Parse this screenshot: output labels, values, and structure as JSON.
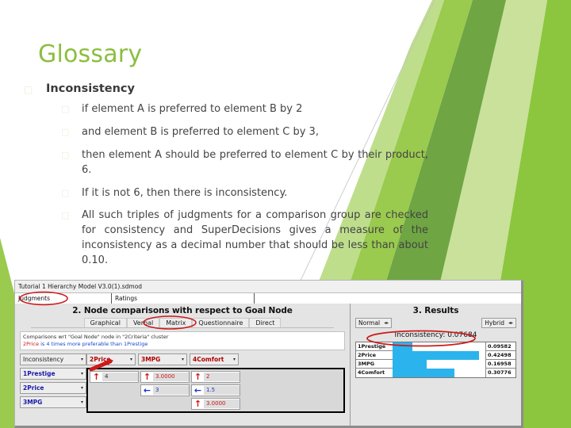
{
  "slide": {
    "title": "Glossary",
    "title_color": "#8CBE3F",
    "bullets": [
      {
        "level": 1,
        "marker": "□",
        "text": "Inconsistency"
      },
      {
        "level": 2,
        "marker": "□",
        "text": "if element A is preferred to element B by 2"
      },
      {
        "level": 2,
        "marker": "□",
        "text": "and element B is preferred to element C by 3,"
      },
      {
        "level": 2,
        "marker": "□",
        "text": "then element A should be preferred to element C by their product, 6."
      },
      {
        "level": 2,
        "marker": "□",
        "text": "If it is not 6, then there is inconsistency."
      },
      {
        "level": 2,
        "marker": "□",
        "text": "All such triples of judgments for a comparison group are checked for consistency and SuperDecisions gives a measure of the inconsistency as a decimal number that should be less than about 0.10."
      }
    ]
  },
  "app": {
    "window_title": "Tutorial 1 Hierarchy Model V3.0(1).sdmod",
    "tabs": [
      {
        "label": "Judgments",
        "circled": true
      },
      {
        "label": "Ratings",
        "circled": false
      }
    ],
    "left_pane": {
      "heading": "2. Node comparisons with respect to Goal Node",
      "method_tabs": [
        {
          "label": "Graphical",
          "selected": false
        },
        {
          "label": "Verbal",
          "selected": false
        },
        {
          "label": "Matrix",
          "selected": true
        },
        {
          "label": "Questionnaire",
          "selected": false
        },
        {
          "label": "Direct",
          "selected": false
        }
      ],
      "note_line1": "Comparisons wrt \"Goal Node\" node in \"2Criteria\" cluster",
      "note_line2_a": "2Price",
      "note_line2_b": "is 4 times more preferable than",
      "note_line2_c": "1Prestige",
      "inconsistency_button": "Inconsistency",
      "column_headers": [
        "2Price",
        "3MPG",
        "4Comfort"
      ],
      "row_headers": [
        "1Prestige",
        "2Price",
        "3MPG"
      ],
      "matrix": [
        [
          {
            "arrow": "up",
            "value": "4"
          },
          {
            "arrow": "up",
            "value": "3.0000"
          },
          {
            "arrow": "up",
            "value": "2"
          }
        ],
        [
          {
            "arrow": "none",
            "value": ""
          },
          {
            "arrow": "left",
            "value": "3"
          },
          {
            "arrow": "left",
            "value": "1.5"
          }
        ],
        [
          {
            "arrow": "none",
            "value": ""
          },
          {
            "arrow": "none",
            "value": ""
          },
          {
            "arrow": "up",
            "value": "3.0000"
          }
        ]
      ]
    },
    "right_pane": {
      "heading": "3. Results",
      "normalize_select": "Normal",
      "mode_select": "Hybrid",
      "inconsistency_label": "Inconsistency: 0.07684",
      "results": [
        {
          "name": "1Prestige",
          "value": "0.09582",
          "bar_pct": 21
        },
        {
          "name": "2Price",
          "value": "0.42498",
          "bar_pct": 93
        },
        {
          "name": "3MPG",
          "value": "0.16958",
          "bar_pct": 37
        },
        {
          "name": "4Comfort",
          "value": "0.30776",
          "bar_pct": 67
        }
      ]
    }
  },
  "colors": {
    "title_green": "#8CBE3F",
    "bullet_marker": "#EDEDD8",
    "body_text": "#434343",
    "bar_blue": "#2BB3ED",
    "ink_red": "#CC1A1A"
  }
}
